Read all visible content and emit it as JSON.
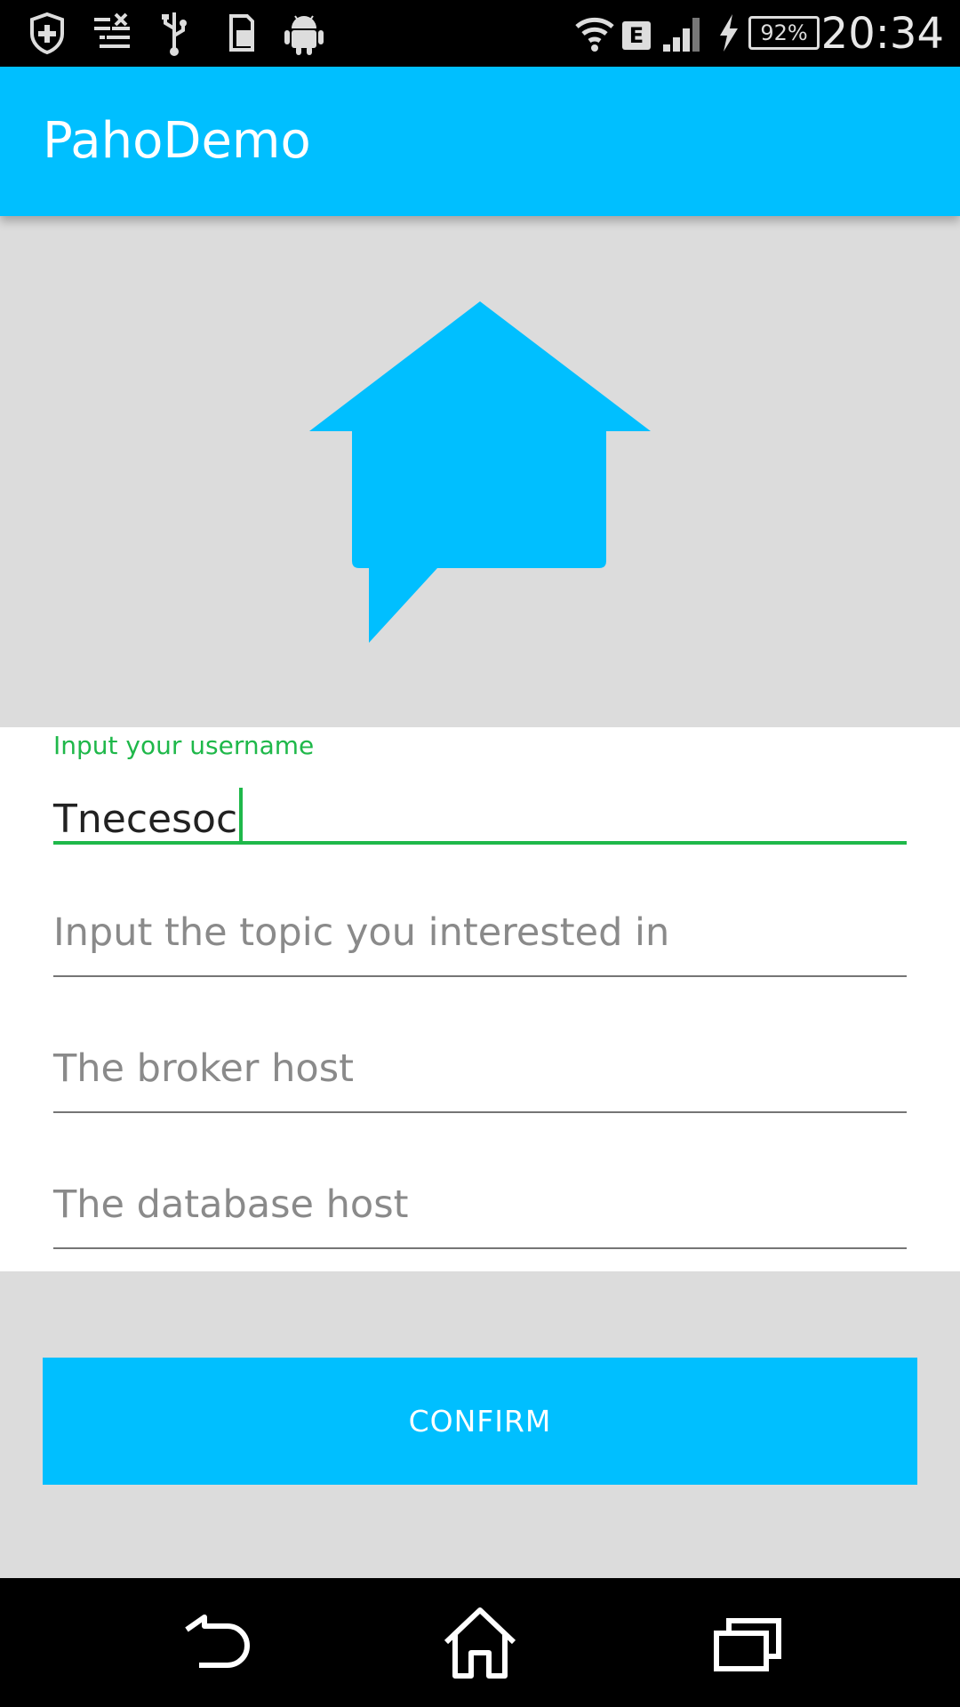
{
  "status_bar": {
    "battery": "92%",
    "time": "20:34",
    "network_type": "E",
    "icons": [
      "shield-icon",
      "notification-clear-icon",
      "usb-icon",
      "sim-icon",
      "android-icon",
      "wifi-icon",
      "network-e-icon",
      "signal-icon",
      "charging-icon",
      "battery-icon"
    ]
  },
  "app_bar": {
    "title": "PahoDemo"
  },
  "hero": {
    "icon": "house-speech-bubble-icon",
    "color": "#00bfff"
  },
  "form": {
    "username": {
      "label": "Input your username",
      "value": "Tnecesoc"
    },
    "topic": {
      "placeholder": "Input the topic you interested in"
    },
    "broker": {
      "placeholder": "The broker host"
    },
    "database": {
      "placeholder": "The database host"
    }
  },
  "confirm_button": {
    "label": "CONFIRM"
  },
  "nav_bar": {
    "icons": [
      "back-icon",
      "home-icon",
      "recents-icon"
    ]
  },
  "colors": {
    "accent": "#00bfff",
    "focus": "#1fb84a",
    "background": "#dcdcdc"
  }
}
